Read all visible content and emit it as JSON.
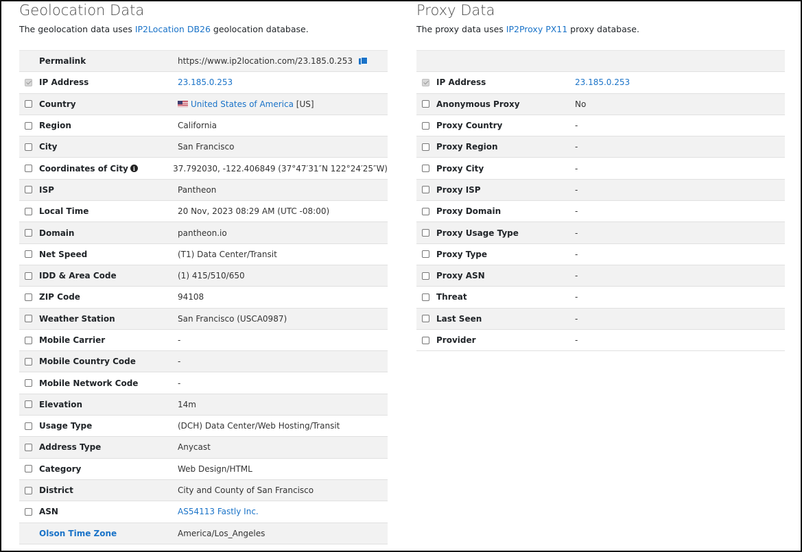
{
  "geo": {
    "title": "Geolocation Data",
    "desc_prefix": "The geolocation data uses ",
    "desc_link": "IP2Location DB26",
    "desc_suffix": " geolocation database.",
    "permalink_label": "Permalink",
    "permalink_value": "https://www.ip2location.com/23.185.0.253",
    "rows": [
      {
        "label": "IP Address",
        "value": "23.185.0.253",
        "checked": true,
        "link": true
      },
      {
        "label": "Country",
        "value": "United States of America",
        "value_suffix": " [US]",
        "checked": false,
        "link": true,
        "flag": true
      },
      {
        "label": "Region",
        "value": "California",
        "checked": false
      },
      {
        "label": "City",
        "value": "San Francisco",
        "checked": false
      },
      {
        "label": "Coordinates of City",
        "value": "37.792030, -122.406849 (37°47′31″N   122°24′25″W)",
        "checked": false,
        "info": true
      },
      {
        "label": "ISP",
        "value": "Pantheon",
        "checked": false
      },
      {
        "label": "Local Time",
        "value": "20 Nov, 2023 08:29 AM (UTC -08:00)",
        "checked": false
      },
      {
        "label": "Domain",
        "value": "pantheon.io",
        "checked": false
      },
      {
        "label": "Net Speed",
        "value": "(T1) Data Center/Transit",
        "checked": false
      },
      {
        "label": "IDD & Area Code",
        "value": "(1) 415/510/650",
        "checked": false
      },
      {
        "label": "ZIP Code",
        "value": "94108",
        "checked": false
      },
      {
        "label": "Weather Station",
        "value": "San Francisco (USCA0987)",
        "checked": false
      },
      {
        "label": "Mobile Carrier",
        "value": "-",
        "checked": false
      },
      {
        "label": "Mobile Country Code",
        "value": "-",
        "checked": false
      },
      {
        "label": "Mobile Network Code",
        "value": "-",
        "checked": false
      },
      {
        "label": "Elevation",
        "value": "14m",
        "checked": false
      },
      {
        "label": "Usage Type",
        "value": "(DCH) Data Center/Web Hosting/Transit",
        "checked": false
      },
      {
        "label": "Address Type",
        "value": "Anycast",
        "checked": false
      },
      {
        "label": "Category",
        "value": "Web Design/HTML",
        "checked": false
      },
      {
        "label": "District",
        "value": "City and County of San Francisco",
        "checked": false
      },
      {
        "label": "ASN",
        "value": "AS54113 Fastly Inc.",
        "checked": false,
        "link": true
      }
    ],
    "olson_label": "Olson Time Zone",
    "olson_value": "America/Los_Angeles"
  },
  "proxy": {
    "title": "Proxy Data",
    "desc_prefix": "The proxy data uses ",
    "desc_link": "IP2Proxy PX11",
    "desc_suffix": " proxy database.",
    "rows": [
      {
        "label": "IP Address",
        "value": "23.185.0.253",
        "checked": true,
        "link": true
      },
      {
        "label": "Anonymous Proxy",
        "value": "No",
        "checked": false
      },
      {
        "label": "Proxy Country",
        "value": "-",
        "checked": false
      },
      {
        "label": "Proxy Region",
        "value": "-",
        "checked": false
      },
      {
        "label": "Proxy City",
        "value": "-",
        "checked": false
      },
      {
        "label": "Proxy ISP",
        "value": "-",
        "checked": false
      },
      {
        "label": "Proxy Domain",
        "value": "-",
        "checked": false
      },
      {
        "label": "Proxy Usage Type",
        "value": "-",
        "checked": false
      },
      {
        "label": "Proxy Type",
        "value": "-",
        "checked": false
      },
      {
        "label": "Proxy ASN",
        "value": "-",
        "checked": false
      },
      {
        "label": "Threat",
        "value": "-",
        "checked": false
      },
      {
        "label": "Last Seen",
        "value": "-",
        "checked": false
      },
      {
        "label": "Provider",
        "value": "-",
        "checked": false
      }
    ]
  },
  "colors": {
    "link": "#1a73c8",
    "row_alt": "#f2f2f2",
    "heading": "#4a4a4a"
  },
  "icons": {
    "copy": "copy-icon",
    "info": "info-icon",
    "flag": "us-flag-icon"
  }
}
